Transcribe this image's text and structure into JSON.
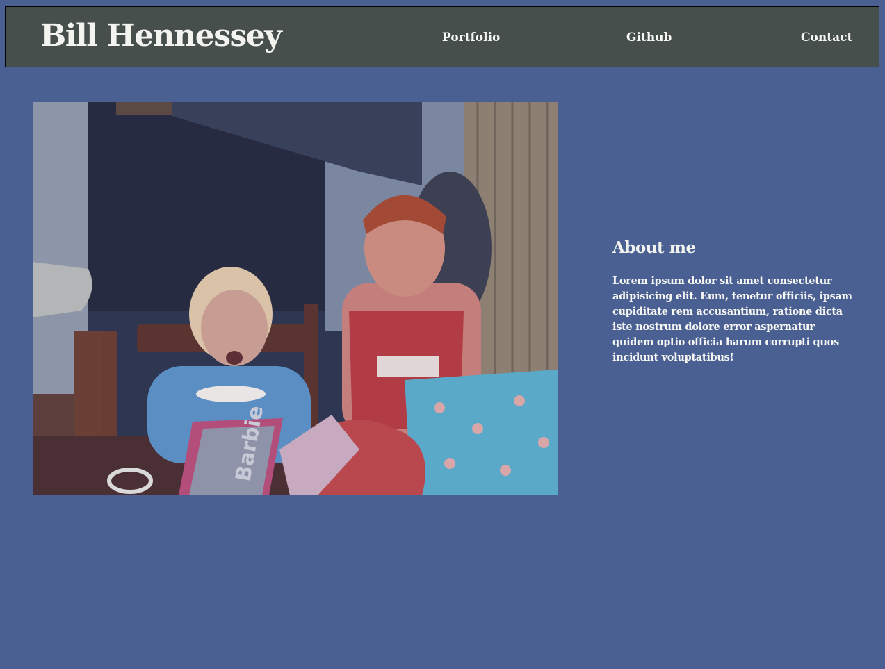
{
  "header": {
    "brand": "Bill Hennessey",
    "nav": [
      {
        "label": "Portfolio"
      },
      {
        "label": "Github"
      },
      {
        "label": "Contact"
      }
    ]
  },
  "about": {
    "title": "About me",
    "body": "Lorem ipsum dolor sit amet consectetur adipisicing elit. Eum, tenetur officiis, ipsam cupiditate rem accusantium, ratione dicta iste nostrum dolore error aspernatur quidem optio officia harum corrupti quos incidunt voluptatibus!"
  },
  "photo": {
    "subject": "childhood-photo",
    "box_text": "Barbie"
  },
  "colors": {
    "page_background": "#4a6093",
    "header_background": "#474f4d",
    "text": "#f1f1ee"
  }
}
